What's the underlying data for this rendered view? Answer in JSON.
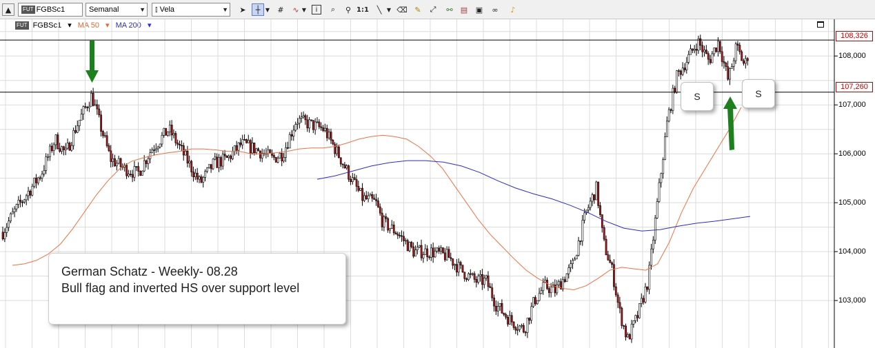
{
  "toolbar": {
    "symbol": "FGBSc1",
    "symbol_badge": "FUT",
    "period": "Semanal",
    "chart_style": "Vela",
    "ratio_label": "1:1"
  },
  "legend": {
    "symbol": "FGBSc1",
    "ma50": "MA 50",
    "ma200": "MA 200"
  },
  "colors": {
    "ma50": "#f07040",
    "ma200": "#2b2bd8",
    "level_line": "#000000",
    "price_tag": "#cc0000",
    "arrow": "#1e7f1e",
    "grid": "#dcdcdc"
  },
  "levels": {
    "upper": "108,326",
    "lower": "107,260"
  },
  "note": {
    "line1": "German Schatz - Weekly- 08.28",
    "line2": "Bull flag and inverted HS over support level"
  },
  "shoulders": [
    "S",
    "S"
  ],
  "chart_data": {
    "type": "candlestick",
    "title": "",
    "ylim": [
      102.1,
      108.75
    ],
    "yticks": [
      "108,000",
      "107,000",
      "106,000",
      "105,000",
      "104,000",
      "103,000"
    ],
    "ytick_values": [
      108,
      107,
      106,
      105,
      104,
      103
    ],
    "horizontal_levels": [
      108.326,
      107.26
    ],
    "grid": true,
    "series": [
      {
        "name": "MA 50",
        "values": [
          103.72,
          103.75,
          103.82,
          103.95,
          104.15,
          104.45,
          104.8,
          105.15,
          105.45,
          105.7,
          105.85,
          105.92,
          105.98,
          106.02,
          106.05,
          106.1,
          106.1,
          106.08,
          106.05,
          106.05,
          106.0,
          106.0,
          106.02,
          106.05,
          106.1,
          106.12,
          106.12,
          106.15,
          106.22,
          106.3,
          106.35,
          106.38,
          106.35,
          106.3,
          106.15,
          105.95,
          105.7,
          105.35,
          105.0,
          104.65,
          104.35,
          104.1,
          103.85,
          103.62,
          103.45,
          103.32,
          103.25,
          103.22,
          103.3,
          103.45,
          103.62,
          103.68,
          103.65,
          103.62,
          103.75,
          104.2,
          104.8,
          105.3,
          105.7,
          106.1,
          106.5,
          106.95
        ]
      },
      {
        "name": "MA 200",
        "values": [
          105.48,
          105.55,
          105.65,
          105.75,
          105.82,
          105.86,
          105.86,
          105.83,
          105.75,
          105.62,
          105.45,
          105.3,
          105.18,
          105.08,
          104.95,
          104.8,
          104.62,
          104.48,
          104.42,
          104.45,
          104.52,
          104.58,
          104.62,
          104.67,
          104.72
        ]
      }
    ]
  }
}
